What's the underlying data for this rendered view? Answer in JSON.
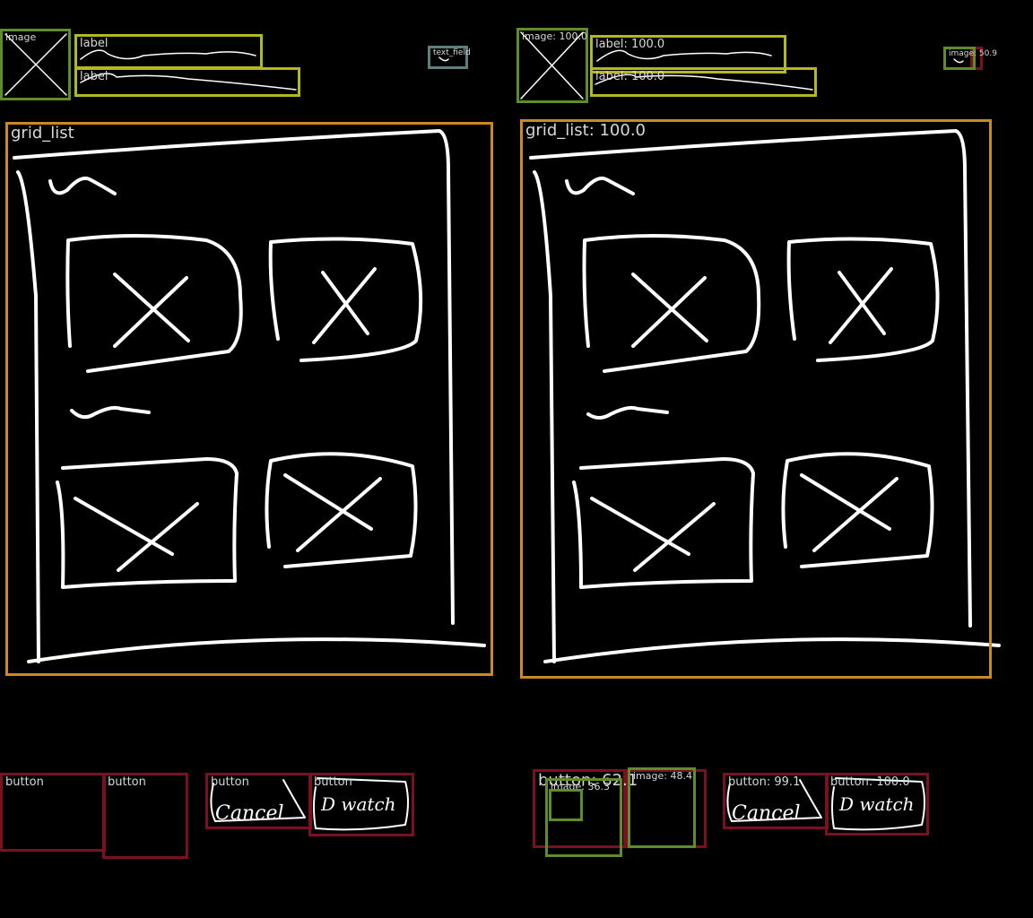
{
  "left": {
    "header_image": "image",
    "label_1": "label",
    "label_2": "label",
    "text_field": "text_field",
    "grid_list": "grid_list",
    "button_1": "button",
    "button_2": "button",
    "button_3": "button",
    "button_4": "button",
    "button_3_sketch_text": "Cancel",
    "button_4_sketch_text": "D watch"
  },
  "right": {
    "header_image": "image: 100.0",
    "label_1": "label: 100.0",
    "label_2": "label: 100.0",
    "small_image": "image: 50.9",
    "grid_list": "grid_list: 100.0",
    "button_1": "button: 62.1",
    "image_1": "image: 36.3",
    "image_2": "image: 48.4",
    "button_2": "button: 99.1",
    "button_3": "button: 100.0",
    "button_2_sketch_text": "Cancel",
    "button_3_sketch_text": "D watch"
  },
  "colors": {
    "image_outline": "#5e8d2b",
    "label_outline": "#b4b820",
    "grid_outline": "#c98a22",
    "button_outline": "#7a1020",
    "text_field_outline": "#5f7f7c",
    "sketch_stroke": "#ffffff"
  }
}
